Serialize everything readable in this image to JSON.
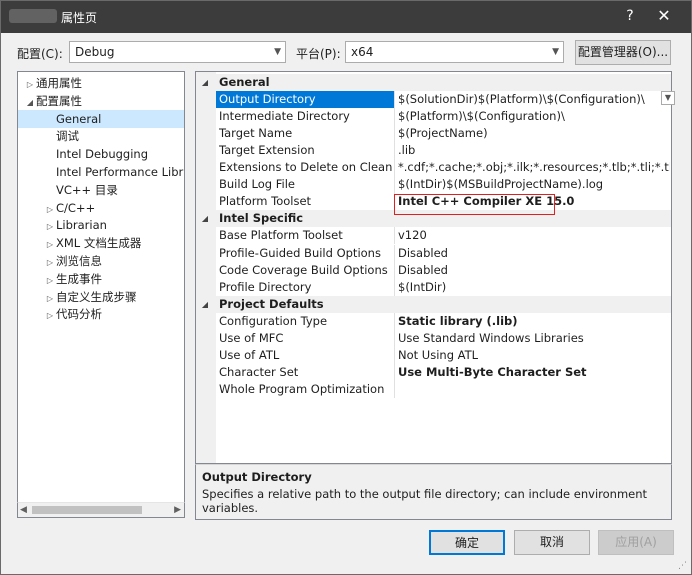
{
  "window": {
    "title": "属性页",
    "help_glyph": "?",
    "close_glyph": "✕"
  },
  "config": {
    "config_label": "配置(C):",
    "config_value": "Debug",
    "platform_label": "平台(P):",
    "platform_value": "x64",
    "manager_label": "配置管理器(O)..."
  },
  "tree": {
    "items": [
      {
        "label": "通用属性",
        "expander": "▷"
      },
      {
        "label": "配置属性",
        "expander": "◢"
      },
      {
        "label": "General",
        "expander": ""
      },
      {
        "label": "调试",
        "expander": ""
      },
      {
        "label": "Intel Debugging",
        "expander": ""
      },
      {
        "label": "Intel Performance Librar",
        "expander": ""
      },
      {
        "label": "VC++ 目录",
        "expander": ""
      },
      {
        "label": "C/C++",
        "expander": "▷"
      },
      {
        "label": "Librarian",
        "expander": "▷"
      },
      {
        "label": "XML 文档生成器",
        "expander": "▷"
      },
      {
        "label": "浏览信息",
        "expander": "▷"
      },
      {
        "label": "生成事件",
        "expander": "▷"
      },
      {
        "label": "自定义生成步骤",
        "expander": "▷"
      },
      {
        "label": "代码分析",
        "expander": "▷"
      }
    ]
  },
  "grid": {
    "categories": [
      {
        "name": "General",
        "rows": [
          {
            "name": "Output Directory",
            "value": "$(SolutionDir)$(Platform)\\$(Configuration)\\"
          },
          {
            "name": "Intermediate Directory",
            "value": "$(Platform)\\$(Configuration)\\"
          },
          {
            "name": "Target Name",
            "value": "$(ProjectName)"
          },
          {
            "name": "Target Extension",
            "value": ".lib"
          },
          {
            "name": "Extensions to Delete on Clean",
            "value": "*.cdf;*.cache;*.obj;*.ilk;*.resources;*.tlb;*.tli;*.tlh;*.tmp;*"
          },
          {
            "name": "Build Log File",
            "value": "$(IntDir)$(MSBuildProjectName).log"
          },
          {
            "name": "Platform Toolset",
            "value": "Intel C++ Compiler XE 15.0"
          }
        ]
      },
      {
        "name": "Intel Specific",
        "rows": [
          {
            "name": "Base Platform Toolset",
            "value": "v120"
          },
          {
            "name": "Profile-Guided Build Options",
            "value": "Disabled"
          },
          {
            "name": "Code Coverage Build Options",
            "value": "Disabled"
          },
          {
            "name": "Profile Directory",
            "value": "$(IntDir)"
          }
        ]
      },
      {
        "name": "Project Defaults",
        "rows": [
          {
            "name": "Configuration Type",
            "value": "Static library (.lib)"
          },
          {
            "name": "Use of MFC",
            "value": "Use Standard Windows Libraries"
          },
          {
            "name": "Use of ATL",
            "value": "Not Using ATL"
          },
          {
            "name": "Character Set",
            "value": "Use Multi-Byte Character Set"
          },
          {
            "name": "Whole Program Optimization",
            "value": ""
          }
        ]
      }
    ]
  },
  "description": {
    "title": "Output Directory",
    "text": "Specifies a relative path to the output file directory; can include environment variables."
  },
  "buttons": {
    "ok": "确定",
    "cancel": "取消",
    "apply": "应用(A)"
  }
}
